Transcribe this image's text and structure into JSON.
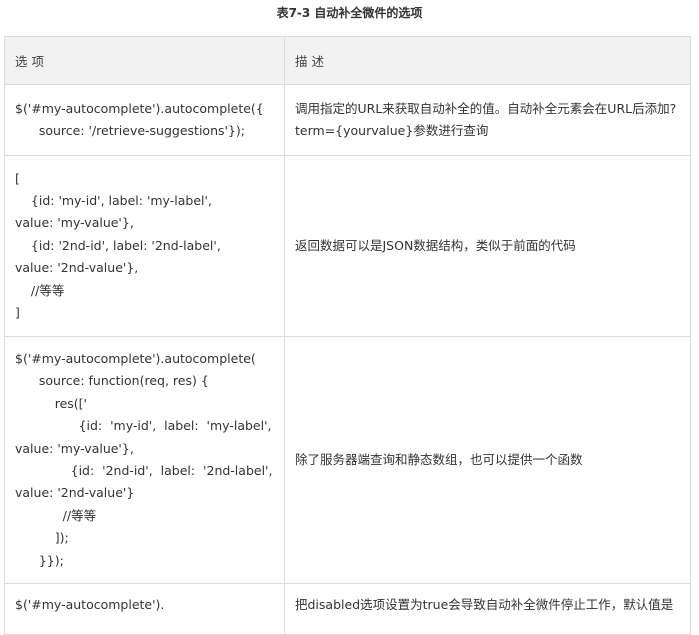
{
  "caption": "表7-3 自动补全微件的选项",
  "table": {
    "headers": [
      "选 项",
      "描 述"
    ],
    "rows": [
      {
        "code": [
          "$('#my-autocomplete').autocomplete({",
          "      source: '/retrieve-suggestions'});"
        ],
        "desc": "调用指定的URL来获取自动补全的值。自动补全元素会在URL后添加?term={yourvalue}参数进行查询"
      },
      {
        "code": [
          "[",
          "    {id: 'my-id', label: 'my-label',",
          "value: 'my-value'},",
          "    {id: '2nd-id', label: '2nd-label',",
          "value: '2nd-value'},",
          "    //等等",
          "]"
        ],
        "desc": "返回数据可以是JSON数据结构，类似于前面的代码"
      },
      {
        "code": [
          "$('#my-autocomplete').autocomplete(",
          "      source: function(req, res) {",
          "          res(['",
          "                {id:  'my-id',  label:  'my-label',",
          "value: 'my-value'},",
          "              {id:  '2nd-id',  label:  '2nd-label',",
          "value: '2nd-value'}",
          "            //等等",
          "          ]);",
          "      }});"
        ],
        "desc": "除了服务器端查询和静态数组，也可以提供一个函数"
      },
      {
        "code": [
          "$('#my-autocomplete')."
        ],
        "desc": "把disabled选项设置为true会导致自动补全微件停止工作，默认值是"
      }
    ]
  }
}
